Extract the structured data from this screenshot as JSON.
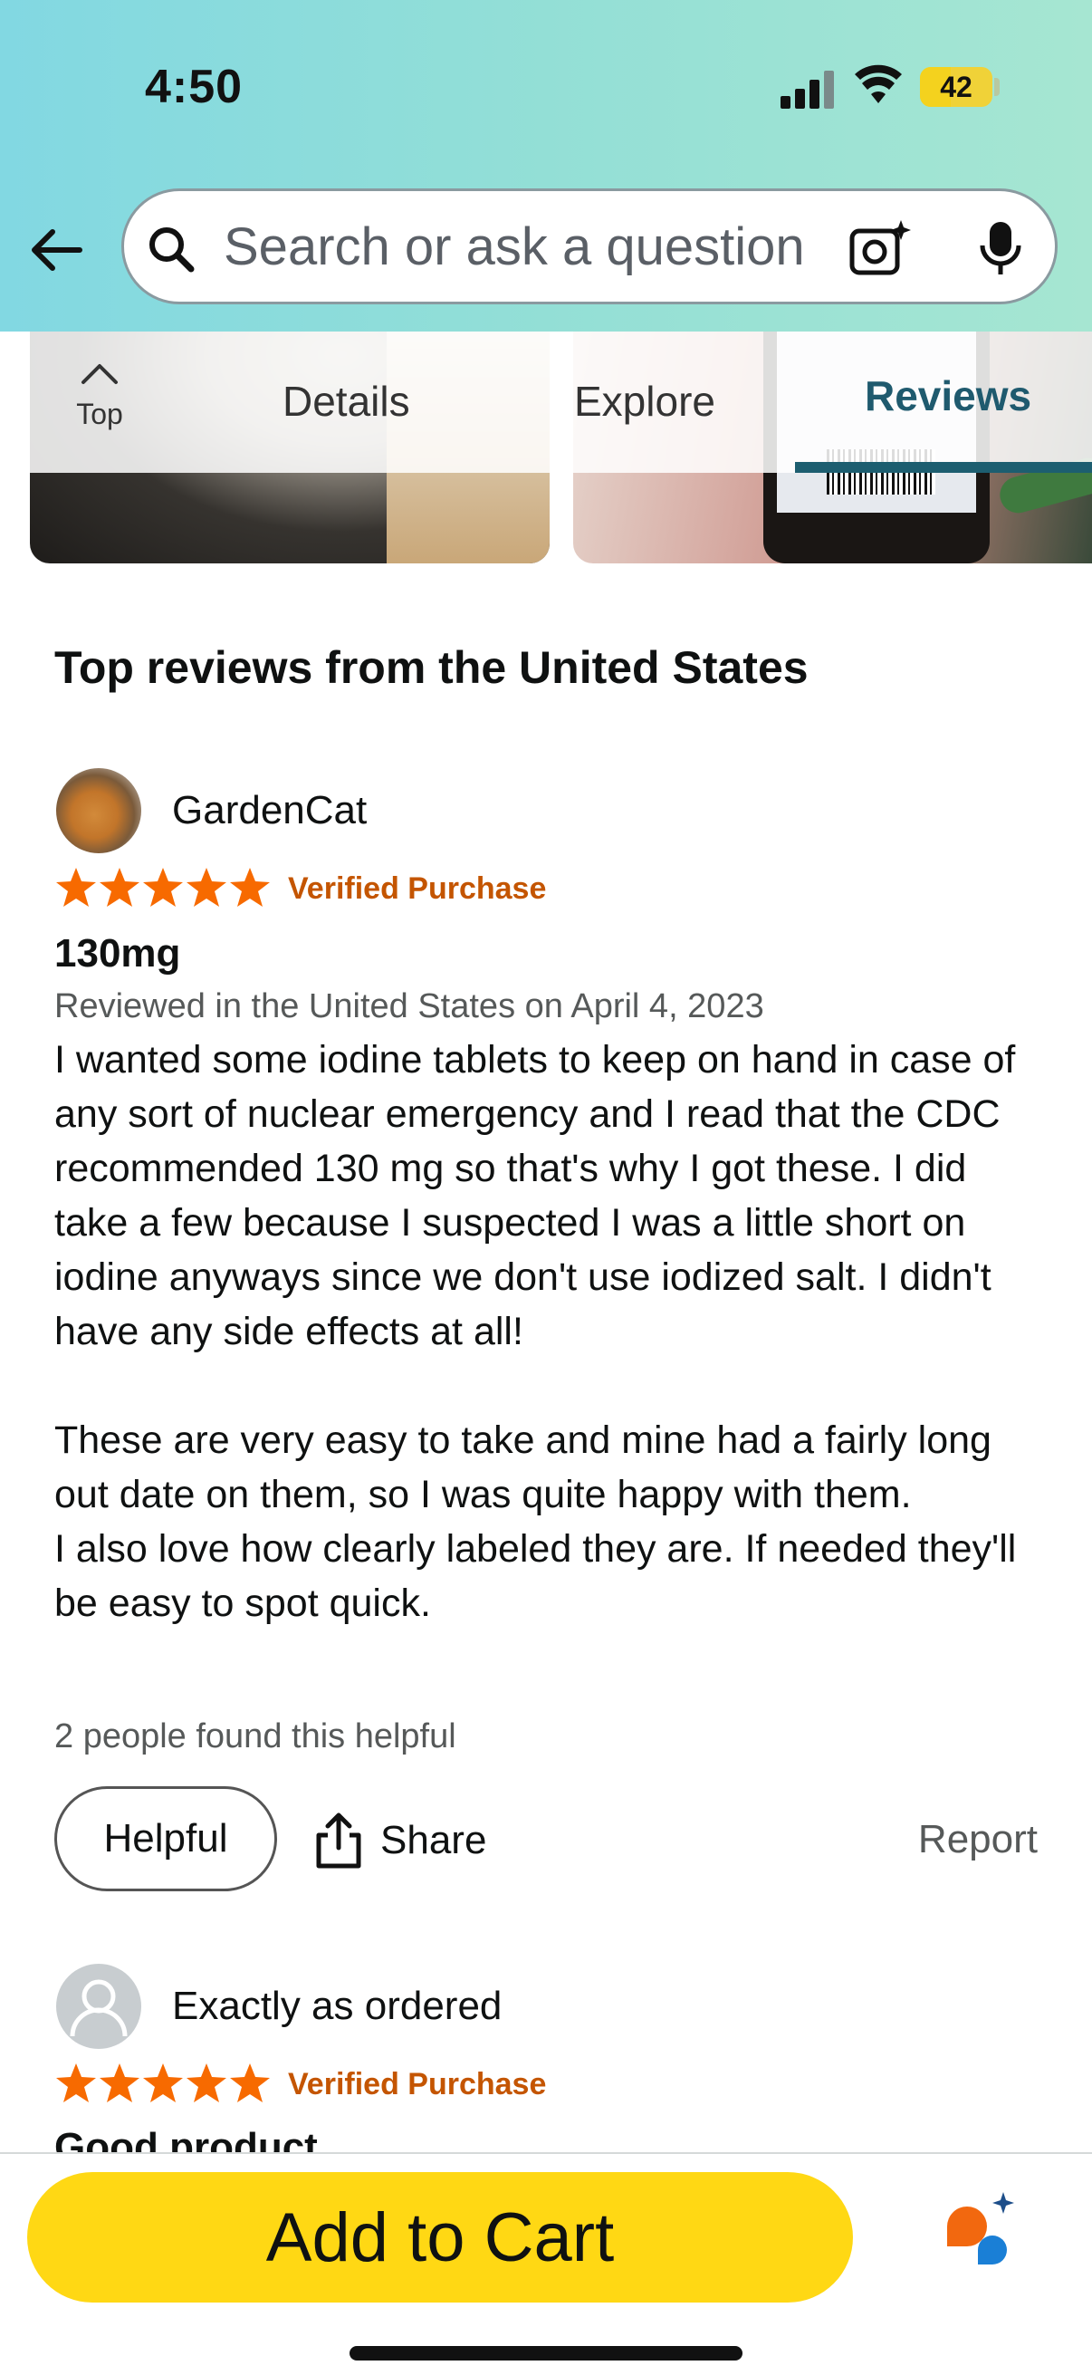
{
  "status_bar": {
    "time": "4:50",
    "battery_percent": "42",
    "battery_level": 0.42
  },
  "search": {
    "placeholder": "Search or ask a question"
  },
  "tabs": {
    "top_label": "Top",
    "details": "Details",
    "explore": "Explore",
    "reviews": "Reviews",
    "active": "Reviews"
  },
  "reviews_section": {
    "title": "Top reviews from the United States",
    "reviews": [
      {
        "author": "GardenCat",
        "rating": 5,
        "verified": "Verified Purchase",
        "title": "130mg",
        "date": "Reviewed in the United States on April 4, 2023",
        "body_paragraph_1": "I wanted some iodine tablets to keep on hand in case of any sort of nuclear emergency and I read that the CDC recommended 130 mg so that's why I got these. I did take a few because I suspected I was a little short on iodine anyways since we don't use iodized salt. I didn't have any side effects at all!",
        "body_paragraph_2": "These are very easy to take and mine had a fairly long out date on them, so I was quite happy with them.",
        "body_paragraph_3": "I also love how clearly labeled they are. If needed they'll be easy to spot quick.",
        "helpful_count": "2 people found this helpful"
      },
      {
        "author": "Exactly as ordered",
        "rating": 5,
        "verified": "Verified Purchase",
        "title": "Good product"
      }
    ],
    "actions": {
      "helpful": "Helpful",
      "share": "Share",
      "report": "Report"
    }
  },
  "bottom_bar": {
    "add_to_cart": "Add to Cart"
  },
  "colors": {
    "star": "#f76a00",
    "verified": "#c45500",
    "cart_button": "#ffd814",
    "active_tab": "#1d5e70"
  }
}
